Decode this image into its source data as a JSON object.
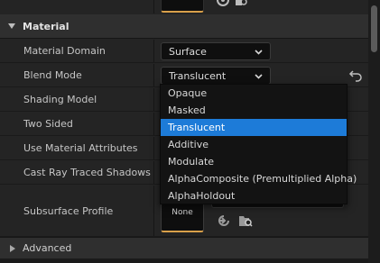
{
  "section": {
    "title": "Material"
  },
  "properties": [
    {
      "label": "Material Domain"
    },
    {
      "label": "Blend Mode"
    },
    {
      "label": "Shading Model"
    },
    {
      "label": "Two Sided"
    },
    {
      "label": "Use Material Attributes"
    },
    {
      "label": "Cast Ray Traced Shadows"
    },
    {
      "label": "Subsurface Profile"
    }
  ],
  "material_domain": {
    "value": "Surface"
  },
  "blend_mode": {
    "value": "Translucent",
    "options": [
      "Opaque",
      "Masked",
      "Translucent",
      "Additive",
      "Modulate",
      "AlphaComposite (Premultiplied Alpha)",
      "AlphaHoldout"
    ],
    "selected_index": 2
  },
  "subsurface_profile": {
    "thumbnail_label": "None"
  },
  "advanced": {
    "title": "Advanced"
  },
  "colors": {
    "selection": "#1d7bd8",
    "thumbnail_accent": "#d9a04a"
  },
  "icons": [
    "reset-to-default-icon",
    "browse-asset-icon",
    "use-selected-icon",
    "chevron-down-icon",
    "collapse-arrow-icon",
    "expand-arrow-icon"
  ]
}
